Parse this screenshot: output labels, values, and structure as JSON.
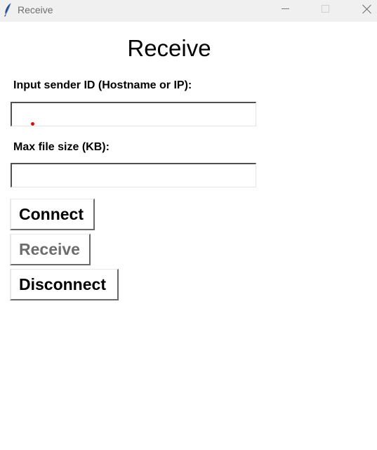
{
  "window": {
    "title": "Receive",
    "icon": "feather-icon",
    "controls": [
      "minimize",
      "maximize",
      "close"
    ]
  },
  "main": {
    "heading": "Receive",
    "sender_label": "Input sender ID (Hostname or IP):",
    "sender_value": "",
    "max_size_label": "Max file size (KB):",
    "max_size_value": ""
  },
  "buttons": {
    "connect": "Connect",
    "receive": "Receive",
    "receive_disabled": true,
    "disconnect": "Disconnect"
  },
  "colors": {
    "titlebar": "#f0f0f0",
    "disabled_text": "#6d6d6d",
    "cursor_marker": "#d01010"
  }
}
